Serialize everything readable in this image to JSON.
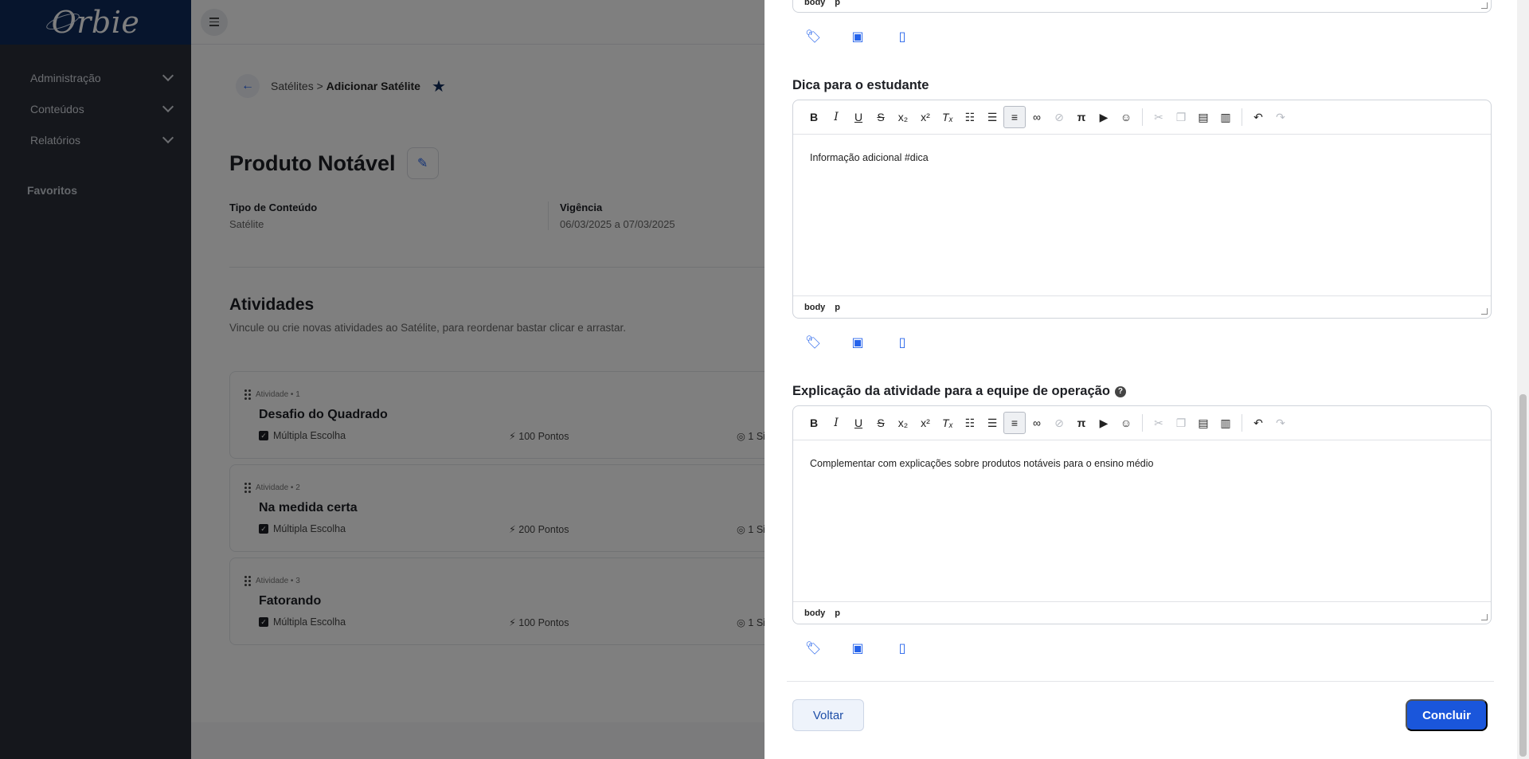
{
  "sidebar": {
    "brand": "Orbie",
    "items": [
      {
        "label": "Administração"
      },
      {
        "label": "Conteúdos"
      },
      {
        "label": "Relatórios"
      }
    ],
    "favorites_label": "Favoritos"
  },
  "breadcrumb": {
    "parent": "Satélites",
    "separator": ">",
    "current": "Adicionar Satélite"
  },
  "page": {
    "title": "Produto Notável",
    "content_type_label": "Tipo de Conteúdo",
    "content_type_value": "Satélite",
    "validity_label": "Vigência",
    "validity_value": "06/03/2025 a 07/03/2025"
  },
  "activities": {
    "title": "Atividades",
    "subtitle": "Vincule ou crie novas atividades ao Satélite, para reordenar bastar clicar e arrastar.",
    "items": [
      {
        "meta": "Atividade • 1",
        "title": "Desafio do Quadrado",
        "type": "Múltipla Escolha",
        "points": "100 Pontos",
        "extra": "1 Si"
      },
      {
        "meta": "Atividade • 2",
        "title": "Na medida certa",
        "type": "Múltipla Escolha",
        "points": "200 Pontos",
        "extra": "1 Si"
      },
      {
        "meta": "Atividade • 3",
        "title": "Fatorando",
        "type": "Múltipla Escolha",
        "points": "100 Pontos",
        "extra": "1 Si"
      }
    ]
  },
  "drawer": {
    "top_status": [
      "body",
      "p"
    ],
    "tip": {
      "label": "Dica para o estudante",
      "content": "Informação adicional #dica",
      "status": [
        "body",
        "p"
      ]
    },
    "explanation": {
      "label": "Explicação da atividade para a equipe de operação",
      "content": "Complementar com explicações sobre produtos notáveis para o ensino médio",
      "status": [
        "body",
        "p"
      ]
    },
    "back_label": "Voltar",
    "done_label": "Concluir"
  },
  "toolbar_icons": [
    "bold-icon",
    "italic-icon",
    "underline-icon",
    "strikethrough-icon",
    "subscript-icon",
    "superscript-icon",
    "clear-format-icon",
    "ordered-list-icon",
    "bullet-list-icon",
    "align-left-icon",
    "link-icon",
    "unlink-icon",
    "math-icon",
    "youtube-icon",
    "emoji-icon",
    "cut-icon",
    "copy-icon",
    "paste-icon",
    "paste-text-icon",
    "undo-icon",
    "redo-icon"
  ]
}
